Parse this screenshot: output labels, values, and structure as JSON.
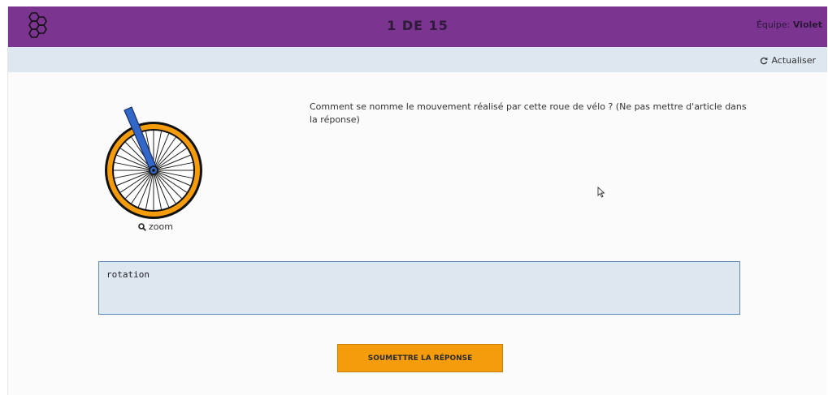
{
  "header": {
    "progress": "1 DE 15",
    "team_label": "Équipe:",
    "team_name": "Violet",
    "logo_icon": "hexagon-cluster-icon",
    "background_color": "#7b3591"
  },
  "toolbar": {
    "refresh_label": "Actualiser",
    "refresh_icon": "refresh-icon"
  },
  "question": {
    "image_icon": "bicycle-wheel-rotation-illustration",
    "zoom_label": "zoom",
    "zoom_icon": "magnifier-icon",
    "text": "Comment se nomme le mouvement réalisé par cette roue de vélo ? (Ne pas mettre d'article dans la réponse)"
  },
  "answer": {
    "value": "rotation"
  },
  "submit": {
    "label": "SOUMETTRE LA RÉPONSE",
    "color": "#f59c0c"
  }
}
